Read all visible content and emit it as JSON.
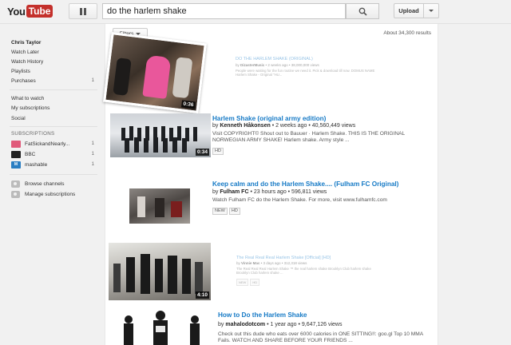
{
  "header": {
    "logo_you": "You",
    "logo_tube": "Tube",
    "search_value": "do the harlem shake",
    "upload_label": "Upload"
  },
  "sidebar": {
    "user_name": "Chris Taylor",
    "items": [
      {
        "label": "Watch Later",
        "count": ""
      },
      {
        "label": "Watch History",
        "count": ""
      },
      {
        "label": "Playlists",
        "count": ""
      },
      {
        "label": "Purchases",
        "count": "1"
      }
    ],
    "nav": [
      {
        "label": "What to watch"
      },
      {
        "label": "My subscriptions"
      },
      {
        "label": "Social"
      }
    ],
    "subscriptions_heading": "SUBSCRIPTIONS",
    "subscriptions": [
      {
        "label": "FatSickandNearly...",
        "count": "1",
        "icon_color": "#e05a7a"
      },
      {
        "label": "BBC",
        "count": "1",
        "icon_color": "#222222"
      },
      {
        "label": "mashable",
        "count": "1",
        "icon_color": "#2a7ec2"
      }
    ],
    "bottom": [
      {
        "label": "Browse channels"
      },
      {
        "label": "Manage subscriptions"
      }
    ]
  },
  "results": {
    "filters_label": "Filters",
    "count_text": "About 34,300 results",
    "videos": [
      {
        "title": "DO THE HARLEM SHAKE (ORIGINAL)",
        "channel": "DizasterMusic",
        "meta_rest": " • 2 weeks ago • 38,000,000 views",
        "desc": "People were waiting for the fun routine we need it. Pick & download till now. DOMUS NAME Harlem Shake - Original \"HU...",
        "duration": "0:36",
        "badges": []
      },
      {
        "title": "Harlem Shake (original army edition)",
        "channel": "Kenneth Håkonsen",
        "meta_rest": " • 2 weeks ago • 40,560,449 views",
        "desc": "Visit COPYRIGHT© Shout out to Bauuer · Harlem Shake. THIS IS THE ORIGINAL NORWEGIAN ARMY SHAKE! Harlem shake. Army style ...",
        "duration": "0:34",
        "badges": [
          "HD"
        ]
      },
      {
        "title": "Keep calm and do the Harlem Shake.... (Fulham FC Original)",
        "channel": "Fulham FC",
        "meta_rest": " • 23 hours ago • 596,811 views",
        "desc": "Watch Fulham FC do the Harlem Shake. For more, visit www.fulhamfc.com",
        "duration": "",
        "badges": [
          "NEW",
          "HD"
        ]
      },
      {
        "title": "The Real Real Real Harlem Shake [Official] [HD]",
        "channel": "Vinnie Mac",
        "meta_rest": " • 3 days ago • 312,318 views",
        "desc": "The Real Real Real Harlem Shake ™ the real harlem shake Brooklyn Club harlem shake Brooklyn Club harlem shake ...",
        "duration": "4:10",
        "badges": [
          "NEW",
          "HD"
        ]
      },
      {
        "title": "How to Do the Harlem Shake",
        "channel": "mahalodotcom",
        "meta_rest": " • 1 year ago • 9,647,126 views",
        "desc": "Check out this dude who eats over 6000 calories in ONE SITTING!!: goo.gl Top 10 MMA Fails. WATCH AND SHARE BEFORE YOUR FRIENDS ...",
        "duration": "",
        "badges": []
      }
    ]
  }
}
